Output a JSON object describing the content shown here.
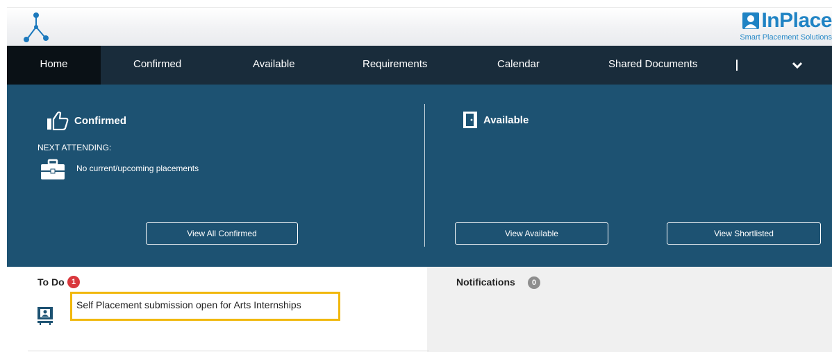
{
  "header": {
    "brand_name": "InPlace",
    "brand_tagline": "Smart Placement Solutions",
    "icons": [
      "molecule-logo-icon",
      "person-card-icon"
    ]
  },
  "nav": {
    "items": [
      {
        "label": "Home",
        "active": true
      },
      {
        "label": "Confirmed"
      },
      {
        "label": "Available"
      },
      {
        "label": "Requirements"
      },
      {
        "label": "Calendar"
      },
      {
        "label": "Shared Documents"
      }
    ],
    "more_icon": "chevron-down-icon"
  },
  "dashboard": {
    "confirmed": {
      "title": "Confirmed",
      "icon": "thumbs-up-icon",
      "next_attending_label": "NEXT ATTENDING:",
      "empty_message": "No current/upcoming placements",
      "empty_icon": "briefcase-icon",
      "button": "View All Confirmed"
    },
    "available": {
      "title": "Available",
      "icon": "door-icon",
      "button_available": "View Available",
      "button_shortlisted": "View Shortlisted"
    }
  },
  "todo": {
    "label": "To Do",
    "count": "1",
    "items": [
      {
        "text": "Self Placement submission open for Arts Internships",
        "icon": "id-card-icon"
      }
    ]
  },
  "notifications": {
    "label": "Notifications",
    "count": "0"
  },
  "colors": {
    "nav_bg": "#192c3b",
    "nav_active_bg": "#0a1116",
    "panel_bg": "#1d5272",
    "brand_blue": "#1f83c4",
    "todo_badge": "#d9373c",
    "notif_badge": "#8e8e8e",
    "highlight": "#f1b80e"
  }
}
